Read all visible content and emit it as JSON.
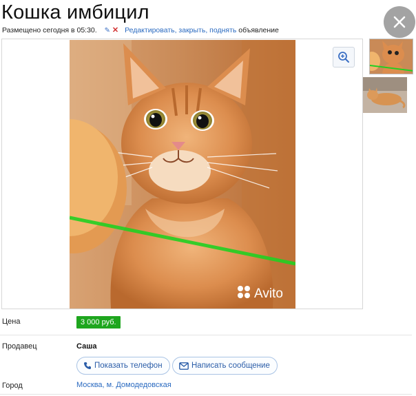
{
  "listing": {
    "title": "Кошка имбицил",
    "posted_text": "Размещено сегодня в 05:30.",
    "actions_link": "Редактировать, закрыть, поднять",
    "actions_suffix": "объявление"
  },
  "gallery": {
    "watermark": "Avito",
    "thumbnails": [
      "cat-thumb-1",
      "cat-thumb-2"
    ]
  },
  "details": {
    "price_label": "Цена",
    "price_value": "3 000 руб.",
    "seller_label": "Продавец",
    "seller_name": "Саша",
    "show_phone_label": "Показать телефон",
    "write_message_label": "Написать сообщение",
    "city_label": "Город",
    "city_value": "Москва, м. Домодедовская"
  },
  "colors": {
    "price_badge": "#1ea61e",
    "link": "#2a6ac0",
    "laser": "#22d022"
  }
}
